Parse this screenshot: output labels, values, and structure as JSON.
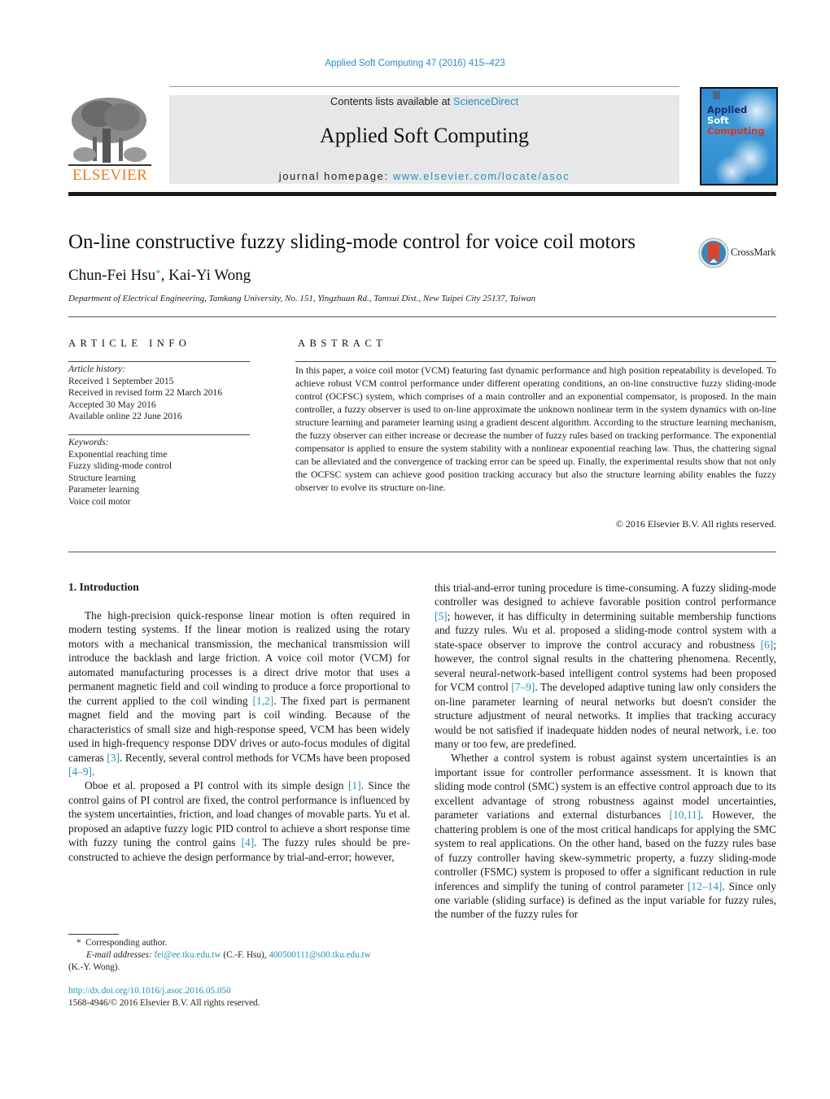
{
  "header": {
    "citation": "Applied Soft Computing 47 (2016) 415–423",
    "contents_prefix": "Contents lists available at ",
    "contents_link": "ScienceDirect",
    "journal_title": "Applied Soft Computing",
    "homepage_prefix": "journal homepage: ",
    "homepage_link": "www.elsevier.com/locate/asoc",
    "publisher_logo_text": "ELSEVIER",
    "cover": {
      "line1": "Applied",
      "line2": "Soft",
      "line3": "Computing"
    }
  },
  "article": {
    "title": "On-line constructive fuzzy sliding-mode control for voice coil motors",
    "crossmark_label": "CrossMark",
    "author1": "Chun-Fei Hsu",
    "author_mark": "*",
    "author_sep": ", ",
    "author2": "Kai-Yi Wong",
    "affiliation": "Department of Electrical Engineering, Tamkang University, No. 151, Yingzhuan Rd., Tamsui Dist., New Taipei City 25137, Taiwan"
  },
  "article_info": {
    "heading": "ARTICLE INFO",
    "history_label": "Article history:",
    "history": [
      "Received 1 September 2015",
      "Received in revised form 22 March 2016",
      "Accepted 30 May 2016",
      "Available online 22 June 2016"
    ],
    "keywords_label": "Keywords:",
    "keywords": [
      "Exponential reaching time",
      "Fuzzy sliding-mode control",
      "Structure learning",
      "Parameter learning",
      "Voice coil motor"
    ]
  },
  "abstract": {
    "heading": "ABSTRACT",
    "text": "In this paper, a voice coil motor (VCM) featuring fast dynamic performance and high position repeatability is developed. To achieve robust VCM control performance under different operating conditions, an on-line constructive fuzzy sliding-mode control (OCFSC) system, which comprises of a main controller and an exponential compensator, is proposed. In the main controller, a fuzzy observer is used to on-line approximate the unknown nonlinear term in the system dynamics with on-line structure learning and parameter learning using a gradient descent algorithm. According to the structure learning mechanism, the fuzzy observer can either increase or decrease the number of fuzzy rules based on tracking performance. The exponential compensator is applied to ensure the system stability with a nonlinear exponential reaching law. Thus, the chattering signal can be alleviated and the convergence of tracking error can be speed up. Finally, the experimental results show that not only the OCFSC system can achieve good position tracking accuracy but also the structure learning ability enables the fuzzy observer to evolve its structure on-line.",
    "copyright": "© 2016 Elsevier B.V. All rights reserved."
  },
  "body": {
    "section_heading": "1.  Introduction",
    "left_p1": [
      "The high-precision quick-response linear motion is often required in modern testing systems. If the linear motion is realized using the rotary motors with a mechanical transmission, the mechanical transmission will introduce the backlash and large friction. A voice coil motor (VCM) for automated manufacturing processes is a direct drive motor that uses a permanent magnetic field and coil winding to produce a force proportional to the current applied to the coil winding ",
      "[1,2]",
      ". The fixed part is permanent magnet field and the moving part is coil winding. Because of the characteristics of small size and high-response speed, VCM has been widely used in high-frequency response DDV drives or auto-focus modules of digital cameras ",
      "[3]",
      ". Recently, several control methods for VCMs have been proposed ",
      "[4–9]",
      "."
    ],
    "left_p2": [
      "Oboe et al. proposed a PI control with its simple design ",
      "[1]",
      ". Since the control gains of PI control are fixed, the control performance is influenced by the system uncertainties, friction, and load changes of movable parts. Yu et al. proposed an adaptive fuzzy logic PID control to achieve a short response time with fuzzy tuning the control gains ",
      "[4]",
      ". The fuzzy rules should be pre-constructed to achieve the design performance by trial-and-error; however,"
    ],
    "right_p1": [
      "this trial-and-error tuning procedure is time-consuming. A fuzzy sliding-mode controller was designed to achieve favorable position control performance ",
      "[5]",
      "; however, it has difficulty in determining suitable membership functions and fuzzy rules. Wu et al. proposed a sliding-mode control system with a state-space observer to improve the control accuracy and robustness ",
      "[6]",
      "; however, the control signal results in the chattering phenomena. Recently, several neural-network-based intelligent control systems had been proposed for VCM control ",
      "[7–9]",
      ". The developed adaptive tuning law only considers the on-line parameter learning of neural networks but doesn't consider the structure adjustment of neural networks. It implies that tracking accuracy would be not satisfied if inadequate hidden nodes of neural network, i.e. too many or too few, are predefined."
    ],
    "right_p2": [
      "Whether a control system is robust against system uncertainties is an important issue for controller performance assessment. It is known that sliding mode control (SMC) system is an effective control approach due to its excellent advantage of strong robustness against model uncertainties, parameter variations and external disturbances ",
      "[10,11]",
      ". However, the chattering problem is one of the most critical handicaps for applying the SMC system to real applications. On the other hand, based on the fuzzy rules base of fuzzy controller having skew-symmetric property, a fuzzy sliding-mode controller (FSMC) system is proposed to offer a significant reduction in rule inferences and simplify the tuning of control parameter ",
      "[12–14]",
      ". Since only one variable (sliding surface) is defined as the input variable for fuzzy rules, the number of the fuzzy rules for"
    ]
  },
  "footnote": {
    "mark": "*",
    "corresponding": "Corresponding author.",
    "email_label": "E-mail addresses:",
    "email1": "fei@ee.tku.edu.tw",
    "email1_owner": " (C.-F. Hsu), ",
    "email2": "400500111@s00.tku.edu.tw",
    "email2_owner": "(K.-Y. Wong).",
    "doi": "http://dx.doi.org/10.1016/j.asoc.2016.05.050",
    "issn": "1568-4946/© 2016 Elsevier B.V. All rights reserved."
  }
}
